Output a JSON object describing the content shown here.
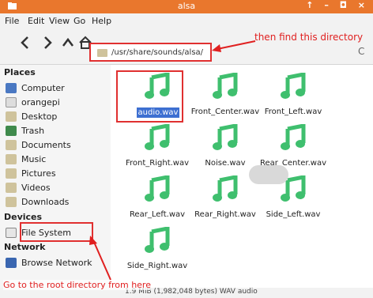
{
  "window": {
    "title": "alsa",
    "controls": [
      "↑",
      "–",
      "◘",
      "×"
    ]
  },
  "menu": [
    "File",
    "Edit",
    "View",
    "Go",
    "Help"
  ],
  "toolbar": {
    "back": "‹",
    "forward": "›",
    "up": "^",
    "home": "⌂",
    "path": "/usr/share/sounds/alsa/",
    "refresh": "C"
  },
  "sidebar": {
    "places_header": "Places",
    "places": [
      {
        "label": "Computer",
        "icon": "computer-icon"
      },
      {
        "label": "orangepi",
        "icon": "home-icon"
      },
      {
        "label": "Desktop",
        "icon": "folder-icon"
      },
      {
        "label": "Trash",
        "icon": "trash-icon"
      },
      {
        "label": "Documents",
        "icon": "folder-icon"
      },
      {
        "label": "Music",
        "icon": "folder-icon"
      },
      {
        "label": "Pictures",
        "icon": "folder-icon"
      },
      {
        "label": "Videos",
        "icon": "folder-icon"
      },
      {
        "label": "Downloads",
        "icon": "folder-icon"
      }
    ],
    "devices_header": "Devices",
    "devices": [
      {
        "label": "File System",
        "icon": "drive-icon"
      }
    ],
    "network_header": "Network",
    "network": [
      {
        "label": "Browse Network",
        "icon": "network-icon"
      }
    ]
  },
  "files": [
    {
      "name": "audio.wav",
      "selected": true
    },
    {
      "name": "Front_Center.wav"
    },
    {
      "name": "Front_Left.wav"
    },
    {
      "name": "Front_Right.wav"
    },
    {
      "name": "Noise.wav"
    },
    {
      "name": "Rear_Center.wav"
    },
    {
      "name": "Rear_Left.wav"
    },
    {
      "name": "Rear_Right.wav"
    },
    {
      "name": "Side_Left.wav"
    },
    {
      "name": "Side_Right.wav"
    }
  ],
  "status": "1.9 MiB (1,982,048 bytes) WAV audio",
  "annotations": {
    "top": "then find this directory",
    "bottom": "Go to the root directory from here"
  },
  "colors": {
    "accent": "#e9772d",
    "highlight": "#e03030",
    "music_icon": "#3fbf6e",
    "selection": "#3d6fd1"
  }
}
